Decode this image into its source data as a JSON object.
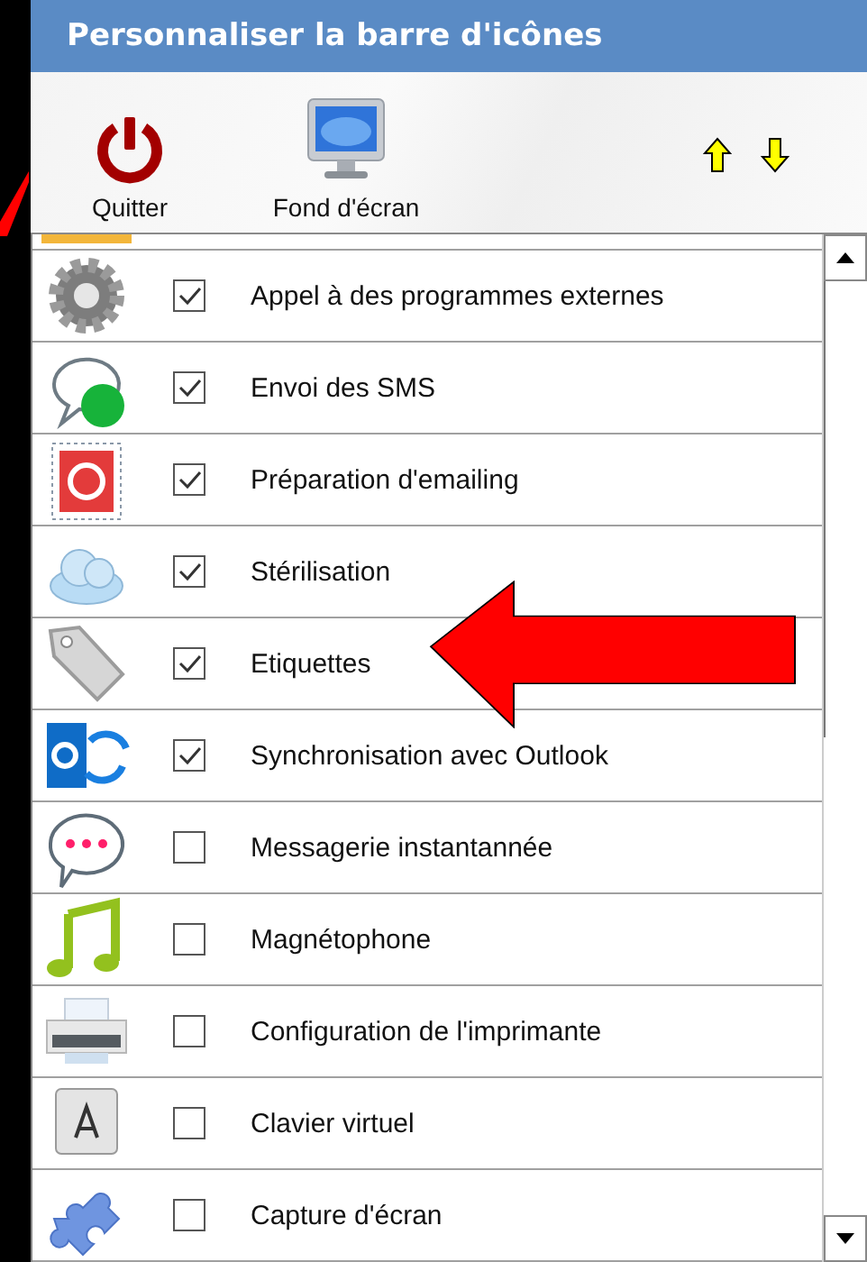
{
  "window": {
    "title": "Personnaliser la barre d'icônes"
  },
  "toolbar": {
    "buttons": [
      {
        "label": "Quitter"
      },
      {
        "label": "Fond d'écran"
      }
    ]
  },
  "items": [
    {
      "label": "Appel à des programmes externes",
      "checked": true
    },
    {
      "label": "Envoi des SMS",
      "checked": true
    },
    {
      "label": "Préparation d'emailing",
      "checked": true
    },
    {
      "label": "Stérilisation",
      "checked": true
    },
    {
      "label": "Etiquettes",
      "checked": true
    },
    {
      "label": "Synchronisation avec Outlook",
      "checked": true
    },
    {
      "label": "Messagerie instantannée",
      "checked": false
    },
    {
      "label": "Magnétophone",
      "checked": false
    },
    {
      "label": "Configuration de l'imprimante",
      "checked": false
    },
    {
      "label": "Clavier virtuel",
      "checked": false
    },
    {
      "label": "Capture d'écran",
      "checked": false
    }
  ]
}
